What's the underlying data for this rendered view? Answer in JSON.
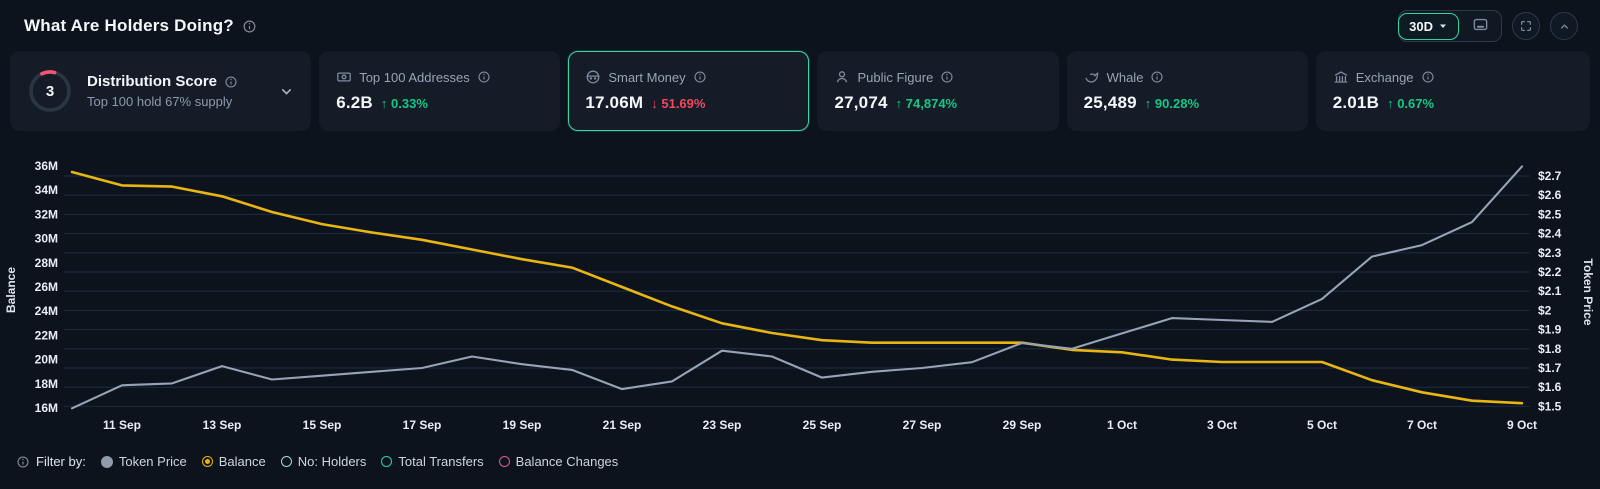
{
  "header": {
    "title": "What Are Holders Doing?",
    "range_label": "30D"
  },
  "cards": [
    {
      "title": "Distribution Score",
      "subtitle": "Top 100 hold 67% supply",
      "score": "3",
      "score_arc_color": "#f2566e"
    },
    {
      "title": "Top 100 Addresses",
      "value": "6.2B",
      "arrow": "↑",
      "change": "0.33%",
      "direction": "up",
      "icon": "banknote-icon"
    },
    {
      "title": "Smart Money",
      "value": "17.06M",
      "arrow": "↓",
      "change": "51.69%",
      "direction": "down",
      "icon": "smart-money-icon",
      "selected": true
    },
    {
      "title": "Public Figure",
      "value": "27,074",
      "arrow": "↑",
      "change": "74,874%",
      "direction": "up",
      "icon": "public-figure-icon"
    },
    {
      "title": "Whale",
      "value": "25,489",
      "arrow": "↑",
      "change": "90.28%",
      "direction": "up",
      "icon": "whale-icon"
    },
    {
      "title": "Exchange",
      "value": "2.01B",
      "arrow": "↑",
      "change": "0.67%",
      "direction": "up",
      "icon": "exchange-icon"
    }
  ],
  "legend": {
    "label": "Filter by:",
    "items": [
      {
        "label": "Token Price",
        "color": "#8f9ba8",
        "style": "filled",
        "selected": false
      },
      {
        "label": "Balance",
        "color": "#e7b50f",
        "style": "selected",
        "selected": true
      },
      {
        "label": "No: Holders",
        "color": "#9fe0c9",
        "style": "hollow",
        "selected": false
      },
      {
        "label": "Total Transfers",
        "color": "#2bd4a0",
        "style": "hollow",
        "selected": false
      },
      {
        "label": "Balance Changes",
        "color": "#e0569d",
        "style": "hollow",
        "selected": false
      }
    ]
  },
  "colors": {
    "background": "#0d131d",
    "card_background": "#151c28",
    "selected_card_border": "#3ad6a6",
    "positive": "#16c784",
    "negative": "#f4465d",
    "balance_line": "#e8b513",
    "price_line": "#95a4b6",
    "gridline": "#1c2c44"
  },
  "chart_data": {
    "type": "line",
    "title": "",
    "x": [
      "10 Sep",
      "11 Sep",
      "12 Sep",
      "13 Sep",
      "14 Sep",
      "15 Sep",
      "16 Sep",
      "17 Sep",
      "18 Sep",
      "19 Sep",
      "20 Sep",
      "21 Sep",
      "22 Sep",
      "23 Sep",
      "24 Sep",
      "25 Sep",
      "26 Sep",
      "27 Sep",
      "28 Sep",
      "29 Sep",
      "30 Sep",
      "1 Oct",
      "2 Oct",
      "3 Oct",
      "4 Oct",
      "5 Oct",
      "6 Oct",
      "7 Oct",
      "8 Oct",
      "9 Oct"
    ],
    "x_tick_labels_shown": [
      "11 Sep",
      "13 Sep",
      "15 Sep",
      "17 Sep",
      "19 Sep",
      "21 Sep",
      "23 Sep",
      "25 Sep",
      "27 Sep",
      "29 Sep",
      "1 Oct",
      "3 Oct",
      "5 Oct",
      "7 Oct",
      "9 Oct"
    ],
    "series": [
      {
        "name": "Balance",
        "axis": "left",
        "color": "#e8b513",
        "unit": "M",
        "values": [
          35.5,
          34.4,
          34.3,
          33.5,
          32.2,
          31.2,
          30.5,
          29.9,
          29.1,
          28.3,
          27.6,
          26.0,
          24.4,
          23.0,
          22.2,
          21.6,
          21.4,
          21.4,
          21.4,
          21.4,
          20.8,
          20.6,
          20.0,
          19.8,
          19.8,
          19.8,
          18.3,
          17.3,
          16.6,
          16.4
        ]
      },
      {
        "name": "Token Price",
        "axis": "right",
        "color": "#95a4b6",
        "unit": "$",
        "values": [
          1.49,
          1.61,
          1.62,
          1.71,
          1.64,
          1.66,
          1.68,
          1.7,
          1.76,
          1.72,
          1.69,
          1.59,
          1.63,
          1.79,
          1.76,
          1.65,
          1.68,
          1.7,
          1.73,
          1.83,
          1.8,
          1.88,
          1.96,
          1.95,
          1.94,
          2.06,
          2.28,
          2.34,
          2.46,
          2.75
        ]
      }
    ],
    "left_axis": {
      "label": "Balance",
      "tick_labels": [
        "36M",
        "34M",
        "32M",
        "30M",
        "28M",
        "26M",
        "24M",
        "22M",
        "20M",
        "18M",
        "16M"
      ],
      "tick_values": [
        36,
        34,
        32,
        30,
        28,
        26,
        24,
        22,
        20,
        18,
        16
      ],
      "min": 16,
      "max": 36
    },
    "right_axis": {
      "label": "Token Price",
      "tick_labels": [
        "$2.7",
        "$2.6",
        "$2.5",
        "$2.4",
        "$2.3",
        "$2.2",
        "$2.1",
        "$2",
        "$1.9",
        "$1.8",
        "$1.7",
        "$1.6",
        "$1.5"
      ],
      "tick_values": [
        2.7,
        2.6,
        2.5,
        2.4,
        2.3,
        2.2,
        2.1,
        2.0,
        1.9,
        1.8,
        1.7,
        1.6,
        1.5
      ],
      "min": 1.5,
      "max": 2.7
    },
    "grid": "horizontal",
    "legend_position": "bottom-left"
  }
}
